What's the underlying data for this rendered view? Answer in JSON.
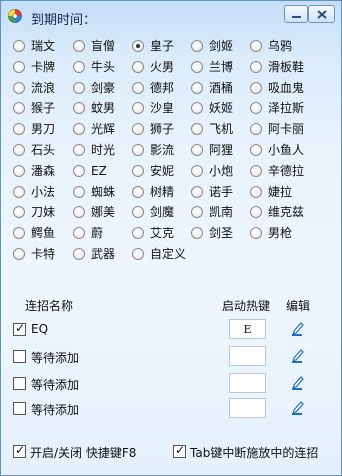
{
  "window": {
    "title": "到期时间：",
    "min_icon": "minimize-icon",
    "close_icon": "close-icon",
    "accent": "#5f93c4"
  },
  "heroes": [
    {
      "label": "瑞文",
      "selected": false
    },
    {
      "label": "盲僧",
      "selected": false
    },
    {
      "label": "皇子",
      "selected": true
    },
    {
      "label": "剑姬",
      "selected": false
    },
    {
      "label": "乌鸦",
      "selected": false
    },
    {
      "label": "卡牌",
      "selected": false
    },
    {
      "label": "牛头",
      "selected": false
    },
    {
      "label": "火男",
      "selected": false
    },
    {
      "label": "兰博",
      "selected": false
    },
    {
      "label": "滑板鞋",
      "selected": false
    },
    {
      "label": "流浪",
      "selected": false
    },
    {
      "label": "剑豪",
      "selected": false
    },
    {
      "label": "德邦",
      "selected": false
    },
    {
      "label": "酒桶",
      "selected": false
    },
    {
      "label": "吸血鬼",
      "selected": false
    },
    {
      "label": "猴子",
      "selected": false
    },
    {
      "label": "蚊男",
      "selected": false
    },
    {
      "label": "沙皇",
      "selected": false
    },
    {
      "label": "妖姬",
      "selected": false
    },
    {
      "label": "泽拉斯",
      "selected": false
    },
    {
      "label": "男刀",
      "selected": false
    },
    {
      "label": "光辉",
      "selected": false
    },
    {
      "label": "狮子",
      "selected": false
    },
    {
      "label": "飞机",
      "selected": false
    },
    {
      "label": "阿卡丽",
      "selected": false
    },
    {
      "label": "石头",
      "selected": false
    },
    {
      "label": "时光",
      "selected": false
    },
    {
      "label": "影流",
      "selected": false
    },
    {
      "label": "阿狸",
      "selected": false
    },
    {
      "label": "小鱼人",
      "selected": false
    },
    {
      "label": "潘森",
      "selected": false
    },
    {
      "label": "EZ",
      "selected": false
    },
    {
      "label": "安妮",
      "selected": false
    },
    {
      "label": "小炮",
      "selected": false
    },
    {
      "label": "辛德拉",
      "selected": false
    },
    {
      "label": "小法",
      "selected": false
    },
    {
      "label": "蜘蛛",
      "selected": false
    },
    {
      "label": "树精",
      "selected": false
    },
    {
      "label": "诺手",
      "selected": false
    },
    {
      "label": "婕拉",
      "selected": false
    },
    {
      "label": "刀妹",
      "selected": false
    },
    {
      "label": "娜美",
      "selected": false
    },
    {
      "label": "剑魔",
      "selected": false
    },
    {
      "label": "凯南",
      "selected": false
    },
    {
      "label": "维克兹",
      "selected": false
    },
    {
      "label": "鳄鱼",
      "selected": false
    },
    {
      "label": "蔚",
      "selected": false
    },
    {
      "label": "艾克",
      "selected": false
    },
    {
      "label": "剑圣",
      "selected": false
    },
    {
      "label": "男枪",
      "selected": false
    },
    {
      "label": "卡特",
      "selected": false
    },
    {
      "label": "武器",
      "selected": false
    },
    {
      "label": "自定义",
      "selected": false
    }
  ],
  "combo": {
    "header_name": "连招名称",
    "header_hotkey": "启动热键",
    "header_edit": "编辑",
    "rows": [
      {
        "checked": true,
        "name": "EQ",
        "hotkey": "E",
        "edit_icon": "edit-pencil-icon"
      },
      {
        "checked": false,
        "name": "等待添加",
        "hotkey": "",
        "edit_icon": "edit-pencil-icon"
      },
      {
        "checked": false,
        "name": "等待添加",
        "hotkey": "",
        "edit_icon": "edit-pencil-icon"
      },
      {
        "checked": false,
        "name": "等待添加",
        "hotkey": "",
        "edit_icon": "edit-pencil-icon"
      }
    ]
  },
  "options": {
    "toggle_label": "开启/关闭 快捷键F8",
    "toggle_checked": true,
    "tab_label": "Tab键中断施放中的连招",
    "tab_checked": true
  }
}
